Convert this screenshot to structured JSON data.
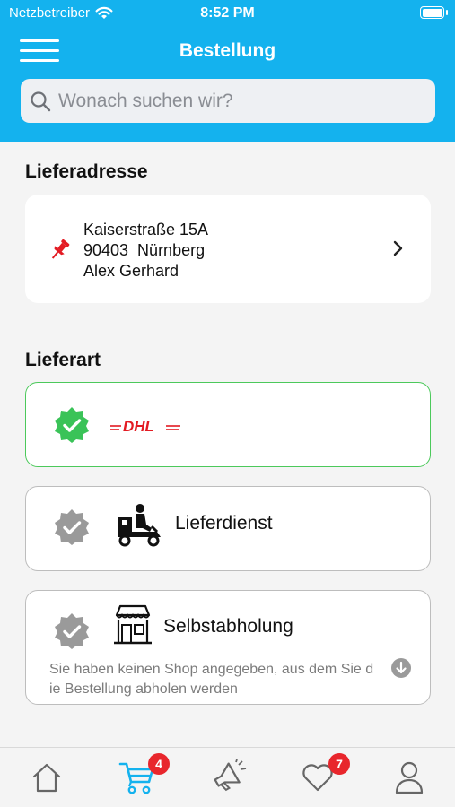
{
  "status_bar": {
    "carrier": "Netzbetreiber",
    "time": "8:52 PM"
  },
  "header": {
    "title": "Bestellung"
  },
  "search": {
    "placeholder": "Wonach suchen wir?"
  },
  "delivery_address": {
    "title": "Lieferadresse",
    "street": "Kaiserstraße 15A",
    "city": "90403  Nürnberg",
    "name": "Alex Gerhard"
  },
  "delivery_type": {
    "title": "Lieferart",
    "options": [
      {
        "label": "DHL",
        "selected": true
      },
      {
        "label": "Lieferdienst",
        "selected": false
      },
      {
        "label": "Selbstabholung",
        "selected": false,
        "note": "Sie haben keinen Shop angegeben, aus dem Sie die Bestellung abholen werden"
      }
    ]
  },
  "tabbar": {
    "items": [
      {
        "name": "home"
      },
      {
        "name": "cart",
        "count": "4",
        "active": true
      },
      {
        "name": "promotions"
      },
      {
        "name": "favorites",
        "count": "7"
      },
      {
        "name": "profile"
      }
    ]
  },
  "colors": {
    "header": "#14b2ee",
    "selected_border": "#4cc95b",
    "badge_selected": "#3ac358",
    "badge_inactive": "#9a9a9a",
    "count_badge": "#e8262c",
    "active_tab": "#14b2ee",
    "pin": "#e31b23",
    "dhl_logo": "#e31b23"
  }
}
